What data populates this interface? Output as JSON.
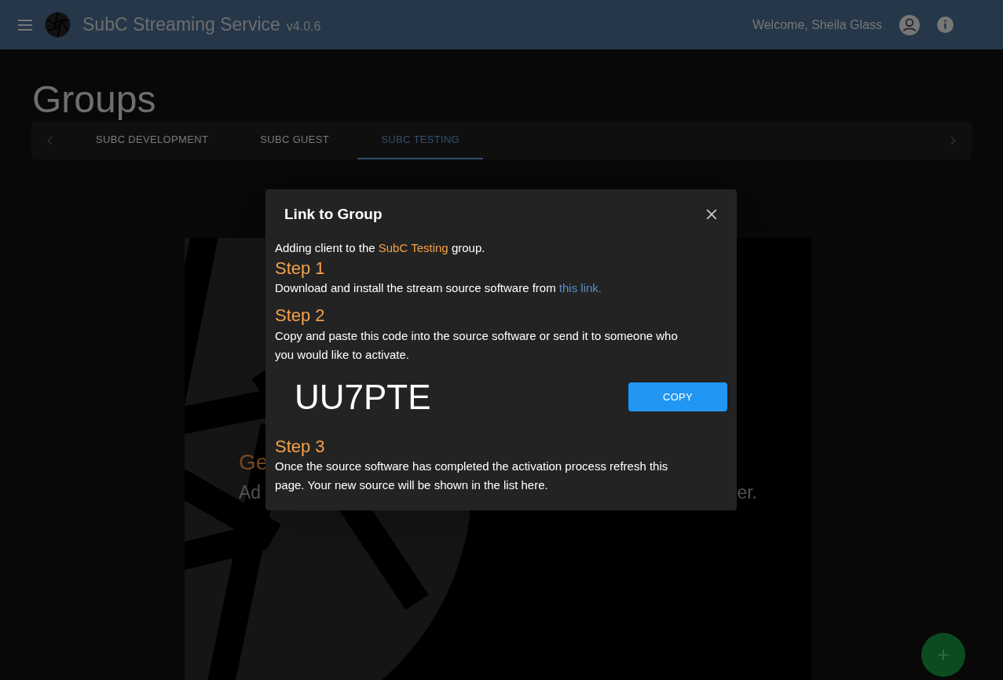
{
  "header": {
    "title": "SubC Streaming Service",
    "version": "v4.0.6",
    "welcome": "Welcome, Sheila Glass"
  },
  "page": {
    "title": "Groups"
  },
  "tabs": [
    {
      "label": "SUBC DEVELOPMENT",
      "selected": false
    },
    {
      "label": "SUBC GUEST",
      "selected": false
    },
    {
      "label": "SUBC TESTING",
      "selected": true
    }
  ],
  "background_text": {
    "heading": "Ge",
    "line_start": "Ad",
    "line_end": "er."
  },
  "dialog": {
    "title": "Link to Group",
    "intro_before": "Adding client to the ",
    "group_name": "SubC Testing",
    "intro_after": " group.",
    "steps": [
      {
        "heading": "Step 1",
        "text": "Download and install the stream source software from ",
        "link": "this link."
      },
      {
        "heading": "Step 2",
        "text": "Copy and paste this code into the source software or send it to someone who you would like to activate.",
        "code": "UU7PTE",
        "button": "COPY"
      },
      {
        "heading": "Step 3",
        "text": "Once the source software has completed the activation process refresh this page. Your new source will be shown in the list here."
      }
    ]
  }
}
